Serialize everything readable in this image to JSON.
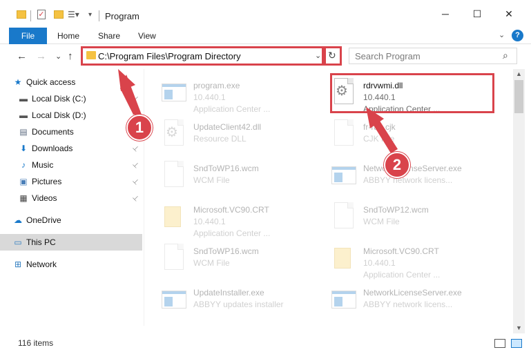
{
  "window": {
    "title": "Program",
    "minimize": "─",
    "maximize": "☐",
    "close": "✕"
  },
  "ribbon": {
    "tabs": [
      "File",
      "Home",
      "Share",
      "View"
    ],
    "expand": "⌄",
    "help": "?"
  },
  "nav": {
    "back": "←",
    "forward": "→",
    "recent": "⌄",
    "up": "↑",
    "address": "C:\\Program Files\\Program Directory",
    "dropdown": "⌄",
    "refresh": "↻",
    "search_placeholder": "Search Program",
    "search_icon": "⌕"
  },
  "sidebar": {
    "items": [
      {
        "label": "Quick access",
        "icon": "star-icon",
        "glyph": "★",
        "color": "#1979ca",
        "pinned": false
      },
      {
        "label": "Local Disk (C:)",
        "icon": "drive-icon",
        "glyph": "▬",
        "color": "#555555",
        "pinned": true
      },
      {
        "label": "Local Disk (D:)",
        "icon": "drive-icon",
        "glyph": "▬",
        "color": "#555555",
        "pinned": true
      },
      {
        "label": "Documents",
        "icon": "documents-icon",
        "glyph": "▤",
        "color": "#5c6b80",
        "pinned": true
      },
      {
        "label": "Downloads",
        "icon": "downloads-icon",
        "glyph": "⬇",
        "color": "#1979ca",
        "pinned": true
      },
      {
        "label": "Music",
        "icon": "music-icon",
        "glyph": "♪",
        "color": "#1979ca",
        "pinned": true
      },
      {
        "label": "Pictures",
        "icon": "pictures-icon",
        "glyph": "▣",
        "color": "#4a7fb8",
        "pinned": true
      },
      {
        "label": "Videos",
        "icon": "videos-icon",
        "glyph": "▦",
        "color": "#444444",
        "pinned": true
      },
      {
        "label": "OneDrive",
        "icon": "onedrive-icon",
        "glyph": "☁",
        "color": "#1979ca",
        "pinned": false
      },
      {
        "label": "This PC",
        "icon": "computer-icon",
        "glyph": "▭",
        "color": "#2e7cc0",
        "pinned": false
      },
      {
        "label": "Network",
        "icon": "network-icon",
        "glyph": "⊞",
        "color": "#2e7cc0",
        "pinned": false
      }
    ],
    "pin_glyph": "📌"
  },
  "files": [
    {
      "name": "program.exe",
      "line2": "10.440.1",
      "line3": "Application Center ...",
      "type": "exe",
      "dim": true
    },
    {
      "name": "rdrvwmi.dll",
      "line2": "10.440.1",
      "line3": "Application Center ...",
      "type": "dll",
      "dim": false
    },
    {
      "name": "UpdateClient42.dll",
      "line2": "Resource DLL",
      "line3": "",
      "type": "dll",
      "dim": true
    },
    {
      "name": "fr-ran.cjk",
      "line2": "CJK File",
      "line3": "",
      "type": "doc",
      "dim": true
    },
    {
      "name": "SndToWP16.wcm",
      "line2": "WCM File",
      "line3": "",
      "type": "doc",
      "dim": true
    },
    {
      "name": "NetworkLicenseServer.exe",
      "line2": "ABBYY network licens...",
      "line3": "",
      "type": "win",
      "dim": true
    },
    {
      "name": "Microsoft.VC90.CRT",
      "line2": "10.440.1",
      "line3": "Application Center ...",
      "type": "folder",
      "dim": true
    },
    {
      "name": "SndToWP12.wcm",
      "line2": "WCM File",
      "line3": "",
      "type": "doc",
      "dim": true
    },
    {
      "name": "SndToWP16.wcm",
      "line2": "WCM File",
      "line3": "",
      "type": "doc",
      "dim": true
    },
    {
      "name": "Microsoft.VC90.CRT",
      "line2": "10.440.1",
      "line3": "Application Center ...",
      "type": "folder",
      "dim": true
    },
    {
      "name": "UpdateInstaller.exe",
      "line2": "ABBYY updates installer",
      "line3": "",
      "type": "win",
      "dim": true
    },
    {
      "name": "NetworkLicenseServer.exe",
      "line2": "ABBYY network licens...",
      "line3": "",
      "type": "win",
      "dim": true
    }
  ],
  "status": {
    "count": "116 items"
  },
  "callouts": [
    "1",
    "2"
  ],
  "colors": {
    "accent": "#1979ca",
    "highlight": "#d9434b"
  }
}
